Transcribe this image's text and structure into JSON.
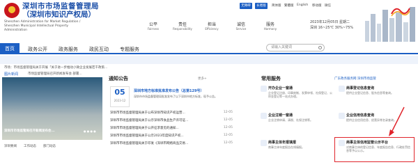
{
  "header": {
    "title": "深圳市市场监督管理局",
    "subtitle": "（深圳市知识产权局）",
    "en_name": "Shenzhen Administration for Market Regulation / Shenzhen Municipal Intellectual Property Administration",
    "btn_a": "无障碍",
    "btn_b": "长者版",
    "links": [
      "简体版",
      "繁體版",
      "English",
      "移动版",
      "微信"
    ],
    "values_cn": [
      "公平",
      "责任",
      "担当",
      "诚信",
      "服务"
    ],
    "values_en": [
      "Fairness",
      "Responsibility",
      "Efficiency",
      "Service",
      "Harmony"
    ],
    "date": "2023年12月05日 星期二",
    "weather": "深圳  16~25℃  30%~75%"
  },
  "nav": {
    "items": [
      "首页",
      "政务公开",
      "政务服务",
      "政民互动",
      "专题服务"
    ],
    "search_placeholder": "请输入关键词"
  },
  "ticker": "市场：市场监督管理局关于开展「关于进一步推动小微企业发展若干政策...",
  "news": {
    "head": "图片新闻",
    "head2": "市场监督管理局召开新闻发布会 部署...",
    "caption": "深圳市市场监管局召开新闻发布会...",
    "tabs": [
      "深圳要闻",
      "工作动态",
      "部门动态"
    ]
  },
  "notices": {
    "title": "通知公告",
    "more": "更多+",
    "featured_day": "05",
    "featured_ym": "2023-12",
    "featured_title": "深圳市地方标准批准发布公告（总第129号）",
    "featured_desc": "深圳市市场监督管理局批准发布了以下深圳市地方标准，现予公告。",
    "rows": [
      {
        "title": "深圳市市场监督管理局关于公布深圳市知识产权运营...",
        "date": "12-05"
      },
      {
        "title": "深圳市市场监督管理局关于公示深圳市食品生产许可证...",
        "date": "12-05"
      },
      {
        "title": "深圳市市场监督管理局关于公开征求意见的通知...",
        "date": "12-05"
      },
      {
        "title": "深圳市市场监督管理局关于公示2023年度知识产权...",
        "date": "12-05"
      },
      {
        "title": "深圳市市场监督管理局关于印发《深圳市网络商品交易...",
        "date": "12-05"
      }
    ]
  },
  "services": {
    "title": "常用服务",
    "banner": "广东政务服务网 深圳市场监管",
    "cards": [
      {
        "name": "开办企业一窗通",
        "desc": "企业登记注册、印章刻制、发票申领、社保登记、公积金登记等一站式办理。"
      },
      {
        "name": "商事登记信息查询",
        "desc": "提供企业登记信息、股东信息等查询。"
      },
      {
        "name": "企业注销一窗通",
        "desc": "企业注销申请、清税、社保注销等。"
      },
      {
        "name": "企业信用信息查询",
        "desc": "提供企业信用信息、经营异常名录查询。"
      },
      {
        "name": "商事主体年报填报",
        "desc": "商事主体年度报告在线填报。"
      },
      {
        "name": "商事主体信用监管公示平台",
        "desc": "对商事主体的登记信息、年度报告信息、行政处罚信息等予以公示。"
      }
    ]
  },
  "colors": {
    "accent": "#1c5fc4",
    "highlight": "#e0242b"
  }
}
